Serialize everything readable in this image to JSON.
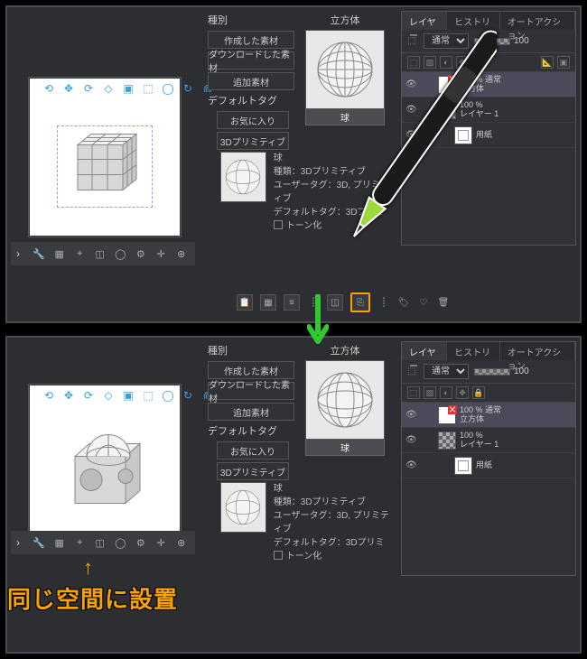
{
  "materials": {
    "heading": "種別",
    "btn_created": "作成した素材",
    "btn_downloaded": "ダウンロードした素材",
    "btn_extra": "追加素材",
    "default_tag": "デフォルトタグ",
    "btn_fav": "お気に入り",
    "btn_3dprim": "3Dプリミティブ"
  },
  "preview": {
    "title": "立方体",
    "footer": "球"
  },
  "props": {
    "name": "球",
    "line1": "種類：3Dプリミティブ",
    "line2": "ユーザータグ：3D, プリミティブ",
    "line3": "デフォルトタグ：3Dプリミ",
    "tone": "トーン化"
  },
  "layers": {
    "tab_layer": "レイヤー",
    "tab_history": "ヒストリー",
    "tab_auto": "オートアクション",
    "mode": "通常",
    "opacity": "100",
    "row1_pct": "100 % 通常",
    "row1_name": "立方体",
    "row2_pct": "100 %",
    "row2_name": "レイヤー 1",
    "row3_name": "用紙"
  },
  "annotation": "同じ空間に設置"
}
